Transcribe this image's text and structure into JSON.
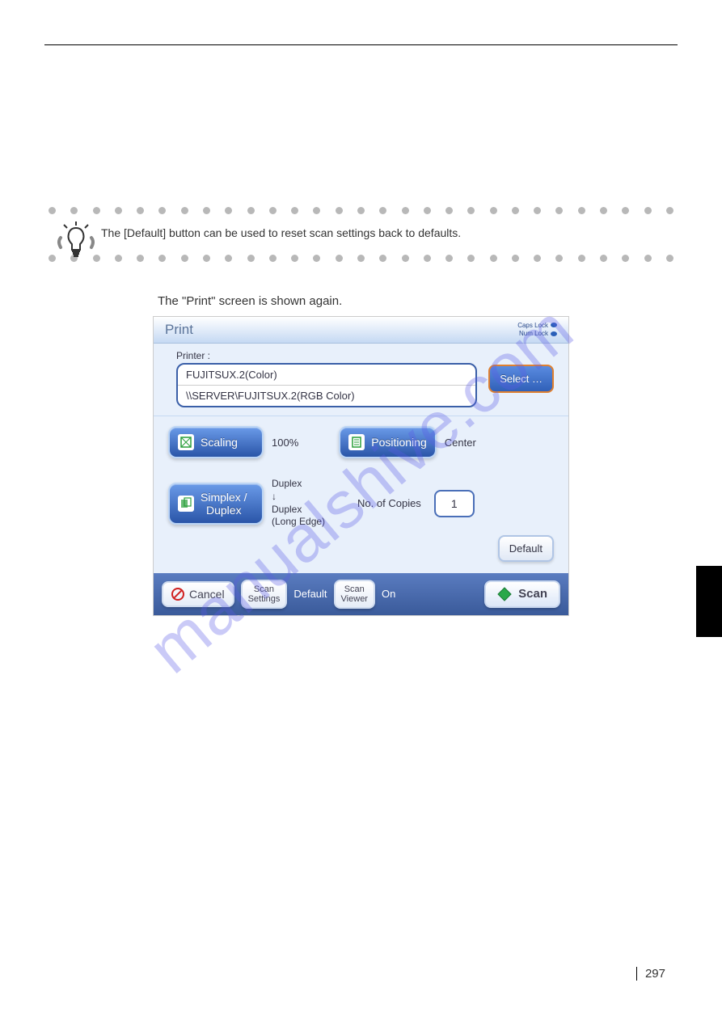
{
  "tip": "The [Default] button can be used to reset scan settings back to defaults.",
  "step": "The \"Print\" screen is shown again.",
  "dialog": {
    "title": "Print",
    "caps_lock": "Caps Lock",
    "num_lock": "Num Lock",
    "printer_label": "Printer :",
    "printer_name": "FUJITSUX.2(Color)",
    "printer_path": "\\\\SERVER\\FUJITSUX.2(RGB Color)",
    "select_label": "Select …",
    "scaling": {
      "label": "Scaling",
      "value": "100%"
    },
    "positioning": {
      "label": "Positioning",
      "value": "Center"
    },
    "duplex": {
      "label": "Simplex /\nDuplex",
      "value_line1": "Duplex",
      "value_arrow": "↓",
      "value_line2": "Duplex",
      "value_line3": "(Long Edge)"
    },
    "copies": {
      "label": "No. of Copies",
      "value": "1"
    },
    "default_label": "Default",
    "footer": {
      "cancel": "Cancel",
      "scan_settings": "Scan\nSettings",
      "scan_settings_value": "Default",
      "scan_viewer": "Scan\nViewer",
      "scan_viewer_value": "On",
      "scan": "Scan"
    }
  },
  "page_number": "297",
  "watermark": "manualshive.com"
}
